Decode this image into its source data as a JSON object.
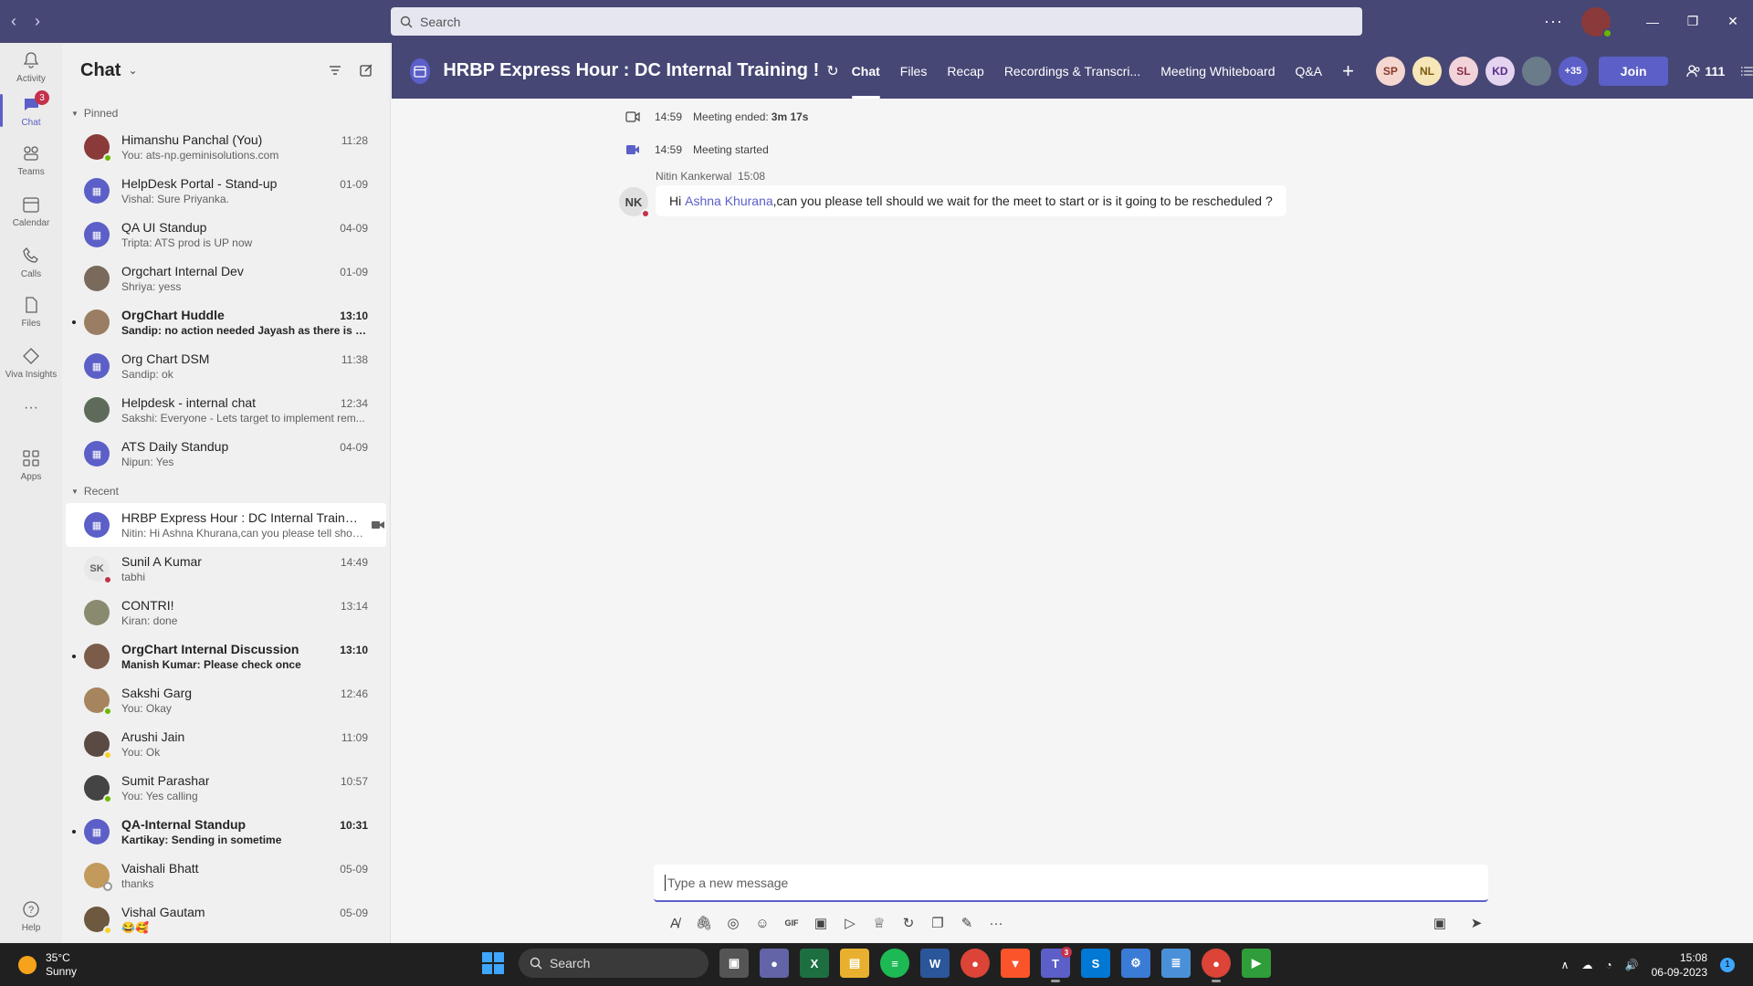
{
  "search": {
    "placeholder": "Search"
  },
  "titlebar": {
    "more": "···"
  },
  "rail": [
    {
      "label": "Activity",
      "icon": "bell-icon"
    },
    {
      "label": "Chat",
      "icon": "chat-icon",
      "badge": "3"
    },
    {
      "label": "Teams",
      "icon": "teams-icon"
    },
    {
      "label": "Calendar",
      "icon": "calendar-icon"
    },
    {
      "label": "Calls",
      "icon": "phone-icon"
    },
    {
      "label": "Files",
      "icon": "file-icon"
    },
    {
      "label": "Viva Insights",
      "icon": "insights-icon"
    },
    {
      "label": "Apps",
      "icon": "apps-icon"
    },
    {
      "label": "Help",
      "icon": "help-icon"
    }
  ],
  "chatlist": {
    "title": "Chat",
    "pinned_label": "Pinned",
    "recent_label": "Recent",
    "pinned": [
      {
        "name": "Himanshu Panchal (You)",
        "time": "11:28",
        "preview": "You: ats-np.geminisolutions.com"
      },
      {
        "name": "HelpDesk Portal - Stand-up",
        "time": "01-09",
        "preview": "Vishal: Sure Priyanka."
      },
      {
        "name": "QA UI Standup",
        "time": "04-09",
        "preview": "Tripta: ATS prod is UP now"
      },
      {
        "name": "Orgchart Internal Dev",
        "time": "01-09",
        "preview": "Shriya: yess"
      },
      {
        "name": "OrgChart Huddle",
        "time": "13:10",
        "preview": "Sandip: no action needed Jayash as there is so..."
      },
      {
        "name": "Org Chart DSM",
        "time": "11:38",
        "preview": "Sandip: ok"
      },
      {
        "name": "Helpdesk - internal chat",
        "time": "12:34",
        "preview": "Sakshi: Everyone - Lets target to implement rem..."
      },
      {
        "name": "ATS Daily Standup",
        "time": "04-09",
        "preview": "Nipun: Yes"
      }
    ],
    "recent": [
      {
        "name": "HRBP Express Hour : DC Internal Training !",
        "time": "",
        "preview": "Nitin: Hi Ashna Khurana,can you please tell shoul..."
      },
      {
        "name": "Sunil A Kumar",
        "time": "14:49",
        "preview": "tabhi",
        "initials": "SK"
      },
      {
        "name": "CONTRI!",
        "time": "13:14",
        "preview": "Kiran: done"
      },
      {
        "name": "OrgChart Internal Discussion",
        "time": "13:10",
        "preview": "Manish Kumar: Please check once"
      },
      {
        "name": "Sakshi Garg",
        "time": "12:46",
        "preview": "You: Okay"
      },
      {
        "name": "Arushi Jain",
        "time": "11:09",
        "preview": "You: Ok"
      },
      {
        "name": "Sumit Parashar",
        "time": "10:57",
        "preview": "You: Yes calling"
      },
      {
        "name": "QA-Internal Standup",
        "time": "10:31",
        "preview": "Kartikay: Sending in sometime"
      },
      {
        "name": "Vaishali Bhatt",
        "time": "05-09",
        "preview": "thanks"
      },
      {
        "name": "Vishal Gautam",
        "time": "05-09",
        "preview": "😂🥰"
      }
    ]
  },
  "header": {
    "title": "HRBP Express Hour : DC Internal Training !",
    "tabs": [
      "Chat",
      "Files",
      "Recap",
      "Recordings & Transcri...",
      "Meeting Whiteboard",
      "Q&A"
    ],
    "people": [
      "SP",
      "NL",
      "SL",
      "KD",
      "",
      "+35"
    ],
    "join": "Join",
    "participants": "111"
  },
  "conversation": {
    "ended_time": "14:59",
    "ended_text": "Meeting ended: ",
    "ended_duration": "3m 17s",
    "started_time": "14:59",
    "started_text": "Meeting started",
    "sender": "Nitin Kankerwal",
    "sent_time": "15:08",
    "sender_initials": "NK",
    "msg_hi": "Hi ",
    "msg_mention": "Ashna Khurana",
    "msg_rest": ",can you please tell should we wait for the meet to start or is it going to be rescheduled ?"
  },
  "composer": {
    "placeholder": "Type a new message"
  },
  "taskbar": {
    "temp": "35°C",
    "weather": "Sunny",
    "search": "Search",
    "time": "15:08",
    "date": "06-09-2023",
    "notifications": "1",
    "teams_badge": "3"
  }
}
